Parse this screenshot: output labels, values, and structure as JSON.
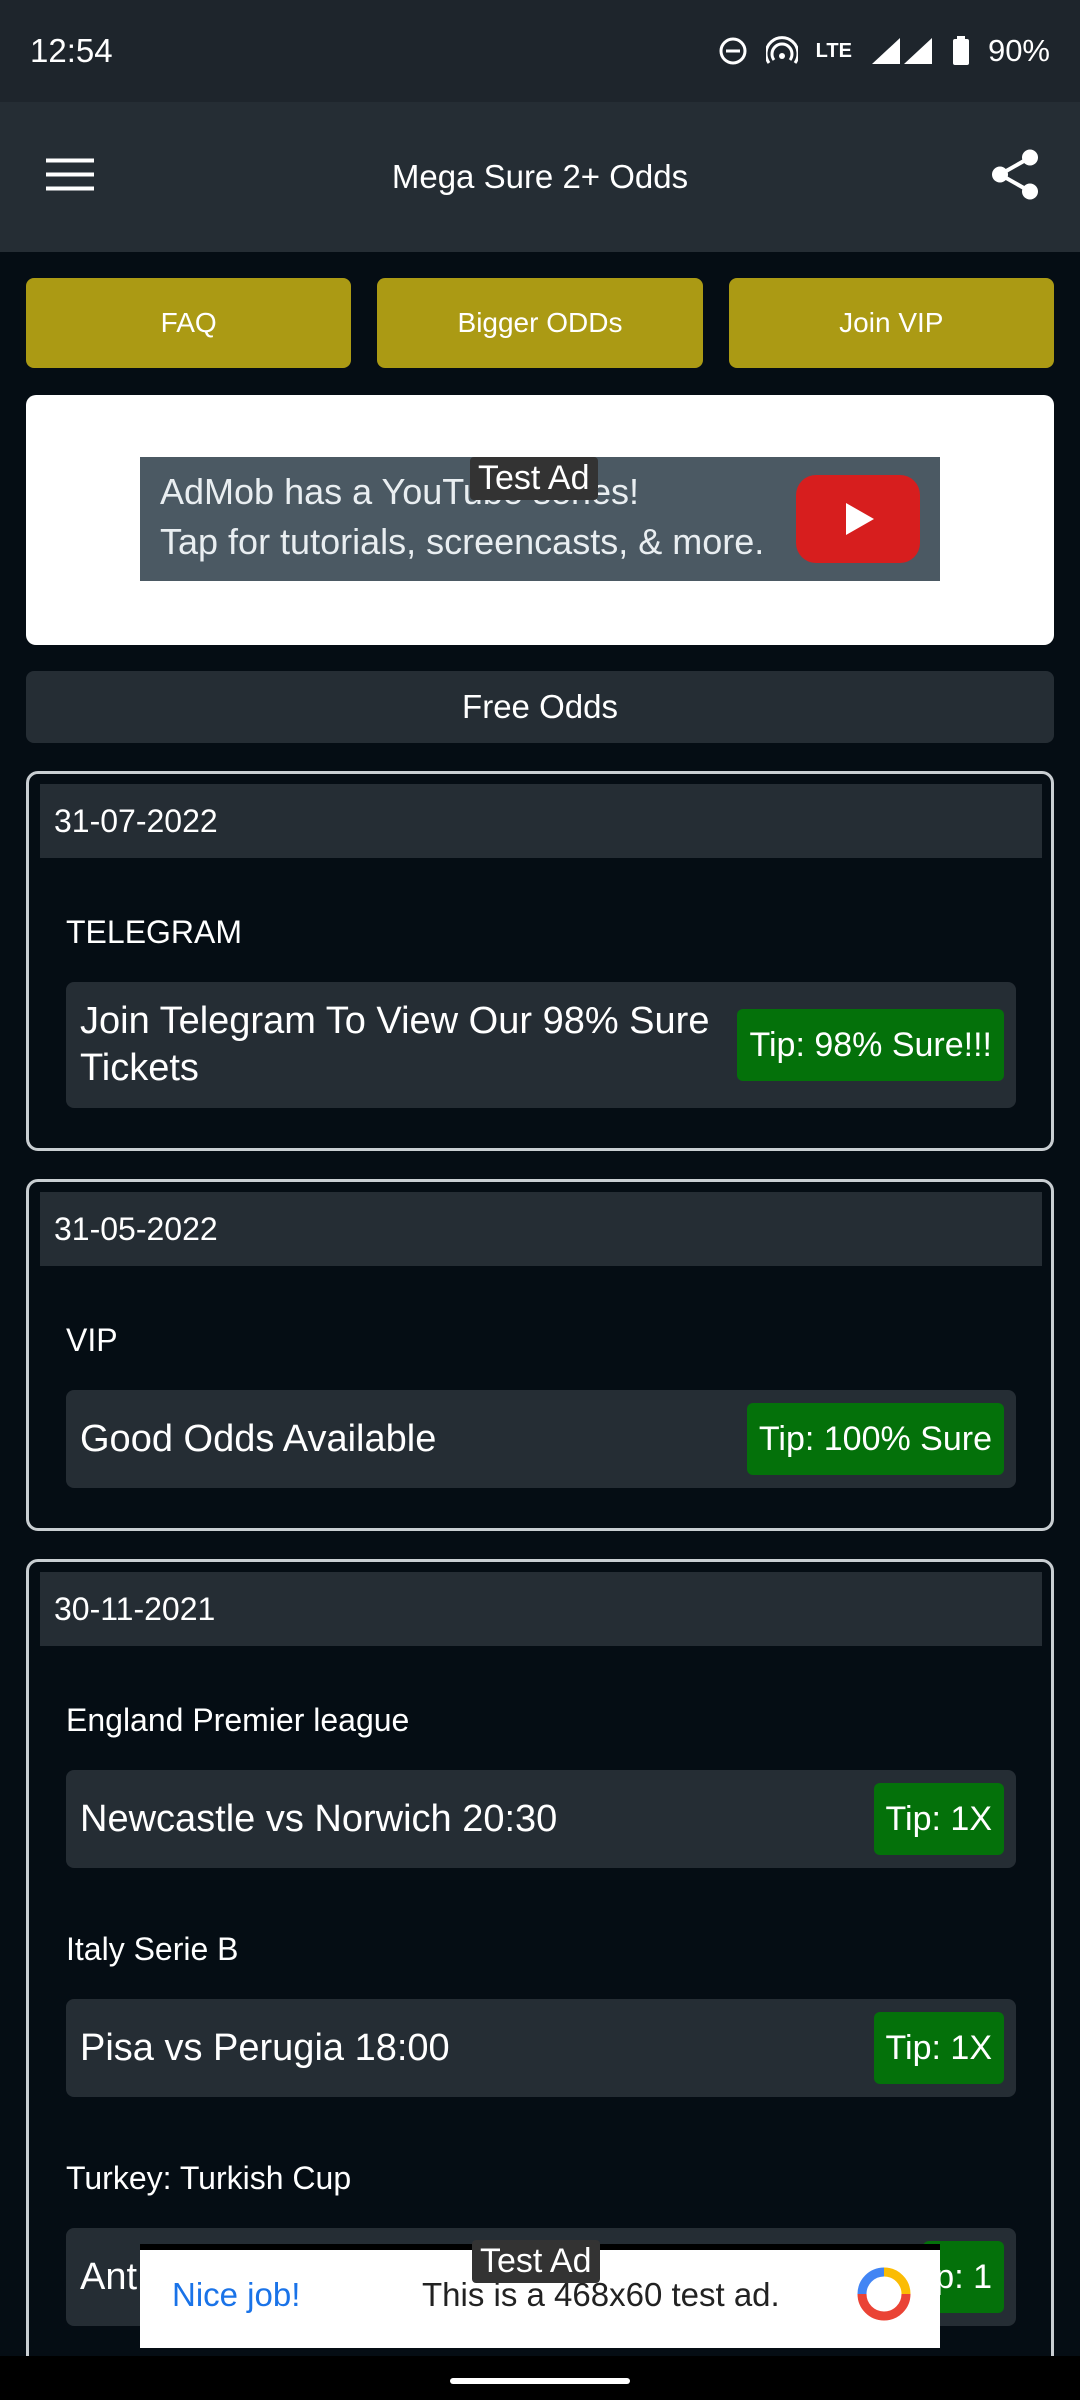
{
  "status_bar": {
    "time": "12:54",
    "battery": "90%",
    "network": "LTE"
  },
  "app_bar": {
    "title": "Mega Sure 2+ Odds",
    "menu_icon": "hamburger-menu-icon",
    "share_icon": "share-icon"
  },
  "top_buttons": [
    {
      "label": "FAQ"
    },
    {
      "label": "Bigger ODDs"
    },
    {
      "label": "Join VIP"
    }
  ],
  "top_ad": {
    "tag": "Test Ad",
    "line1": "AdMob has a YouTube series!",
    "line2": "Tap for tutorials, screencasts, & more."
  },
  "free_odds_label": "Free Odds",
  "cards": [
    {
      "date": "31-07-2022",
      "games": [
        {
          "league": "TELEGRAM",
          "match": "Join Telegram To View Our 98% Sure Tickets",
          "tip": "Tip: 98% Sure!!!"
        }
      ]
    },
    {
      "date": "31-05-2022",
      "games": [
        {
          "league": "VIP",
          "match": "Good Odds Available",
          "tip": "Tip: 100% Sure"
        }
      ]
    },
    {
      "date": "30-11-2021",
      "games": [
        {
          "league": "England Premier league",
          "match": "Newcastle vs Norwich  20:30",
          "tip": "Tip: 1X"
        },
        {
          "league": "Italy Serie B",
          "match": "Pisa vs Perugia   18:00",
          "tip": "Tip: 1X"
        },
        {
          "league": "Turkey: Turkish Cup",
          "match": "Ant",
          "tip": "p: 1"
        }
      ]
    }
  ],
  "bottom_ad": {
    "tag": "Test Ad",
    "nice_job": "Nice job!",
    "text": "This is a 468x60 test ad."
  },
  "colors": {
    "accent_button": "#ab9a14",
    "tip_green": "#04710a",
    "background": "#050d14",
    "surface": "#252d34"
  }
}
